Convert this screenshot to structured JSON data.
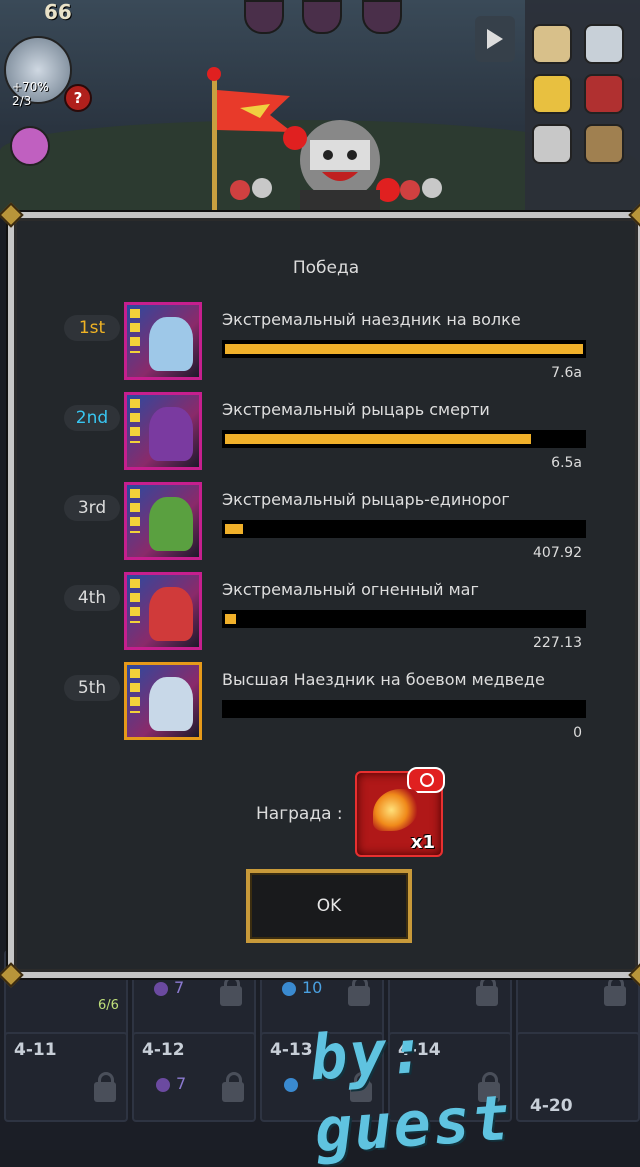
{
  "hud": {
    "counter": "66",
    "avatar_text_line1": "+70%",
    "avatar_text_line2": "2/3",
    "question_mark": "?"
  },
  "result_dialog": {
    "title": "Победа",
    "ranking": [
      {
        "rank": "1st",
        "name": "Экстремальный наездник на волке",
        "value": "7.6a",
        "fill": 1.0,
        "rank_color": "#f0b324",
        "frame_color": "#c61f8e"
      },
      {
        "rank": "2nd",
        "name": "Экстремальный рыцарь смерти",
        "value": "6.5a",
        "fill": 0.855,
        "rank_color": "#38c6f2",
        "frame_color": "#c61f8e"
      },
      {
        "rank": "3rd",
        "name": "Экстремальный рыцарь-единорог",
        "value": "407.92",
        "fill": 0.05,
        "rank_color": "#dcdcdc",
        "frame_color": "#c61f8e"
      },
      {
        "rank": "4th",
        "name": "Экстремальный огненный маг",
        "value": "227.13",
        "fill": 0.03,
        "rank_color": "#dcdcdc",
        "frame_color": "#c61f8e"
      },
      {
        "rank": "5th",
        "name": "Высшая Наездник на боевом медведе",
        "value": "0",
        "fill": 0.0,
        "rank_color": "#dcdcdc",
        "frame_color": "#e69a1a"
      }
    ],
    "reward_label": "Награда :",
    "reward_quantity": "x1",
    "reward_icon": "fire-wing-icon",
    "ok_label": "OK"
  },
  "stage_grid": {
    "tiles": [
      {
        "label": ""
      },
      {
        "label": ""
      },
      {
        "label": ""
      },
      {
        "label": ""
      },
      {
        "label": ""
      },
      {
        "label": "4-11"
      },
      {
        "label": "4-12"
      },
      {
        "label": "4-13"
      },
      {
        "label": "4-14"
      },
      {
        "label": "4-20"
      }
    ],
    "first_tile_count": "6/6",
    "gem_counts": [
      "7",
      "10",
      "7"
    ]
  },
  "watermark": "by: guest"
}
